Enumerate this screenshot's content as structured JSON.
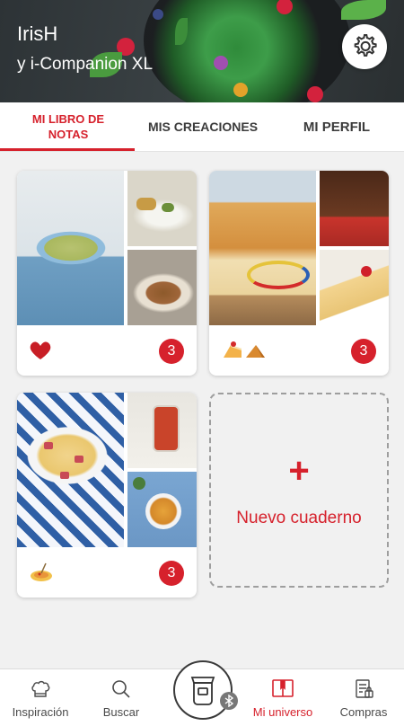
{
  "header": {
    "user_name": "IrisH",
    "device_name": "y i-Companion XL"
  },
  "tabs": [
    {
      "label": "MI LIBRO DE NOTAS",
      "active": true
    },
    {
      "label": "MIS CREACIONES",
      "active": false
    },
    {
      "label": "MI PERFIL",
      "active": false
    }
  ],
  "notebooks": [
    {
      "icon": "heart-icon",
      "count": "3"
    },
    {
      "icon": "cake-slices-icon",
      "count": "3"
    },
    {
      "icon": "pasta-plate-icon",
      "count": "3"
    }
  ],
  "new_notebook": {
    "plus": "+",
    "label": "Nuevo cuaderno"
  },
  "bottom_nav": [
    {
      "label": "Inspiración",
      "icon": "chef-hat-icon",
      "active": false
    },
    {
      "label": "Buscar",
      "icon": "search-icon",
      "active": false
    },
    {
      "label": "Mi universo",
      "icon": "book-icon",
      "active": true
    },
    {
      "label": "Compras",
      "icon": "shopping-list-icon",
      "active": false
    }
  ],
  "colors": {
    "accent": "#d6212c",
    "background": "#f1f1f1"
  }
}
